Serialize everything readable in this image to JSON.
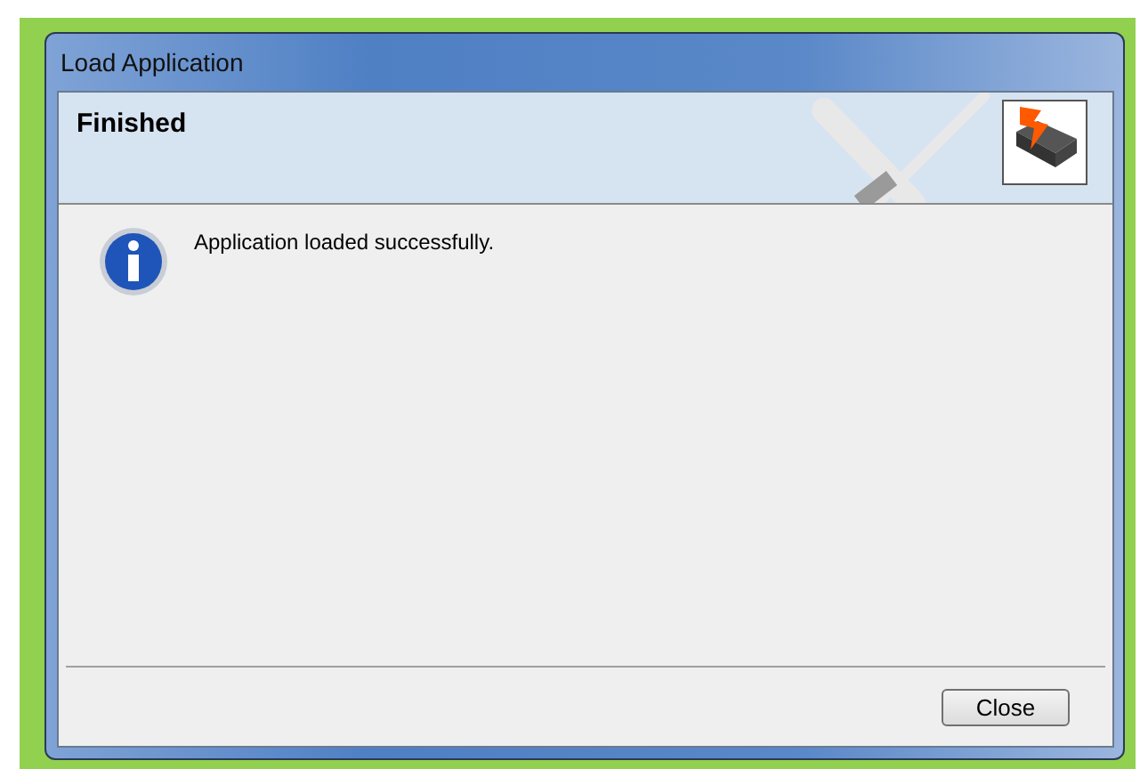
{
  "window": {
    "title": "Load Application"
  },
  "header": {
    "title": "Finished"
  },
  "message": {
    "kind": "info",
    "text": "Application loaded successfully."
  },
  "buttons": [
    {
      "label": "Close"
    }
  ]
}
